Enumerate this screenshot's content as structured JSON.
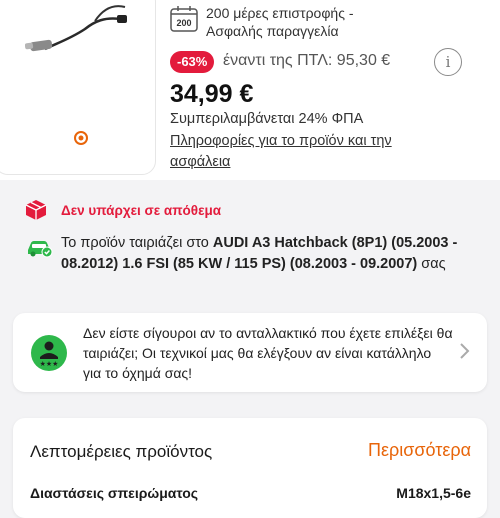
{
  "product": {
    "image_alt": "lambda-sensor-image",
    "return_days_badge": "200",
    "return_line1": "200 μέρες επιστροφής -",
    "return_line2": "Ασφαλής παραγγελία",
    "discount": "-63%",
    "rrp": "έναντι της ΠΤΛ: 95,30 €",
    "info_symbol": "i",
    "price": "34,99 €",
    "vat": "Συμπεριλαμβάνεται 24% ΦΠΑ",
    "info_link_line1": "Πληροφορίες για το προϊόν και την",
    "info_link_line2": "ασφάλεια"
  },
  "stock": {
    "text": "Δεν υπάρχει σε απόθεμα",
    "color": "#e31b3c"
  },
  "fitment": {
    "prefix": "Το προϊόν ταιριάζει στο ",
    "vehicle": "AUDI A3 Hatchback (8P1) (05.2003 - 08.2012) 1.6 FSI (85 KW / 115 PS) (08.2003 - 09.2007)",
    "suffix": " σας"
  },
  "assist": {
    "text": "Δεν είστε σίγουροι αν το ανταλλακτικό που έχετε επιλέξει θα ταιριάζει; Οι τεχνικοί μας θα ελέγξουν αν είναι κατάλληλο για το όχημά σας!",
    "icon_color": "#2eb84b"
  },
  "details": {
    "title": "Λεπτομέρειες προϊόντος",
    "more": "Περισσότερα",
    "spec_label": "Διαστάσεις σπειρώματος",
    "spec_value": "M18x1,5-6e"
  },
  "colors": {
    "accent": "#e8650a",
    "discount": "#e31b3c",
    "success": "#2eb84b"
  }
}
